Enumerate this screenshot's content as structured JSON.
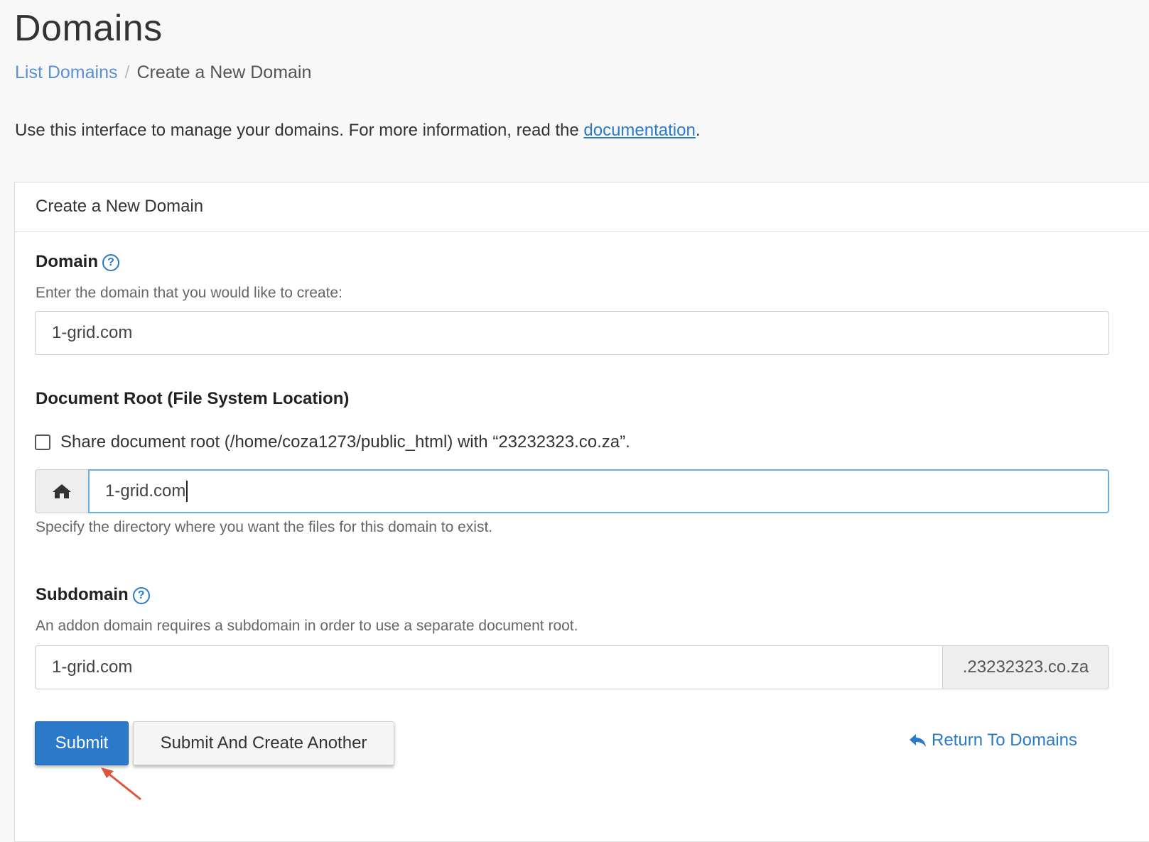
{
  "page": {
    "title": "Domains",
    "breadcrumb": {
      "link": "List Domains",
      "separator": "/",
      "current": "Create a New Domain"
    },
    "intro": {
      "text": "Use this interface to manage your domains. For more information, read the ",
      "link_text": "documentation",
      "suffix": "."
    }
  },
  "panel": {
    "heading": "Create a New Domain",
    "domain": {
      "label": "Domain",
      "help_icon": "question-circle-icon",
      "description": "Enter the domain that you would like to create:",
      "value": "1-grid.com"
    },
    "document_root": {
      "label": "Document Root (File System Location)",
      "share_checkbox_label": "Share document root (/home/coza1273/public_html) with “23232323.co.za”.",
      "share_checked": false,
      "home_icon": "home-icon",
      "value": "1-grid.com",
      "description": "Specify the directory where you want the files for this domain to exist."
    },
    "subdomain": {
      "label": "Subdomain",
      "help_icon": "question-circle-icon",
      "description": "An addon domain requires a subdomain in order to use a separate document root.",
      "value": "1-grid.com",
      "suffix": ".23232323.co.za"
    },
    "actions": {
      "submit": "Submit",
      "submit_another": "Submit And Create Another",
      "return_icon": "reply-arrow-icon",
      "return_link": "Return To Domains"
    }
  },
  "colors": {
    "primary": "#2a7ac9",
    "link": "#5b8fd6",
    "annotation_arrow": "#e0533d"
  }
}
